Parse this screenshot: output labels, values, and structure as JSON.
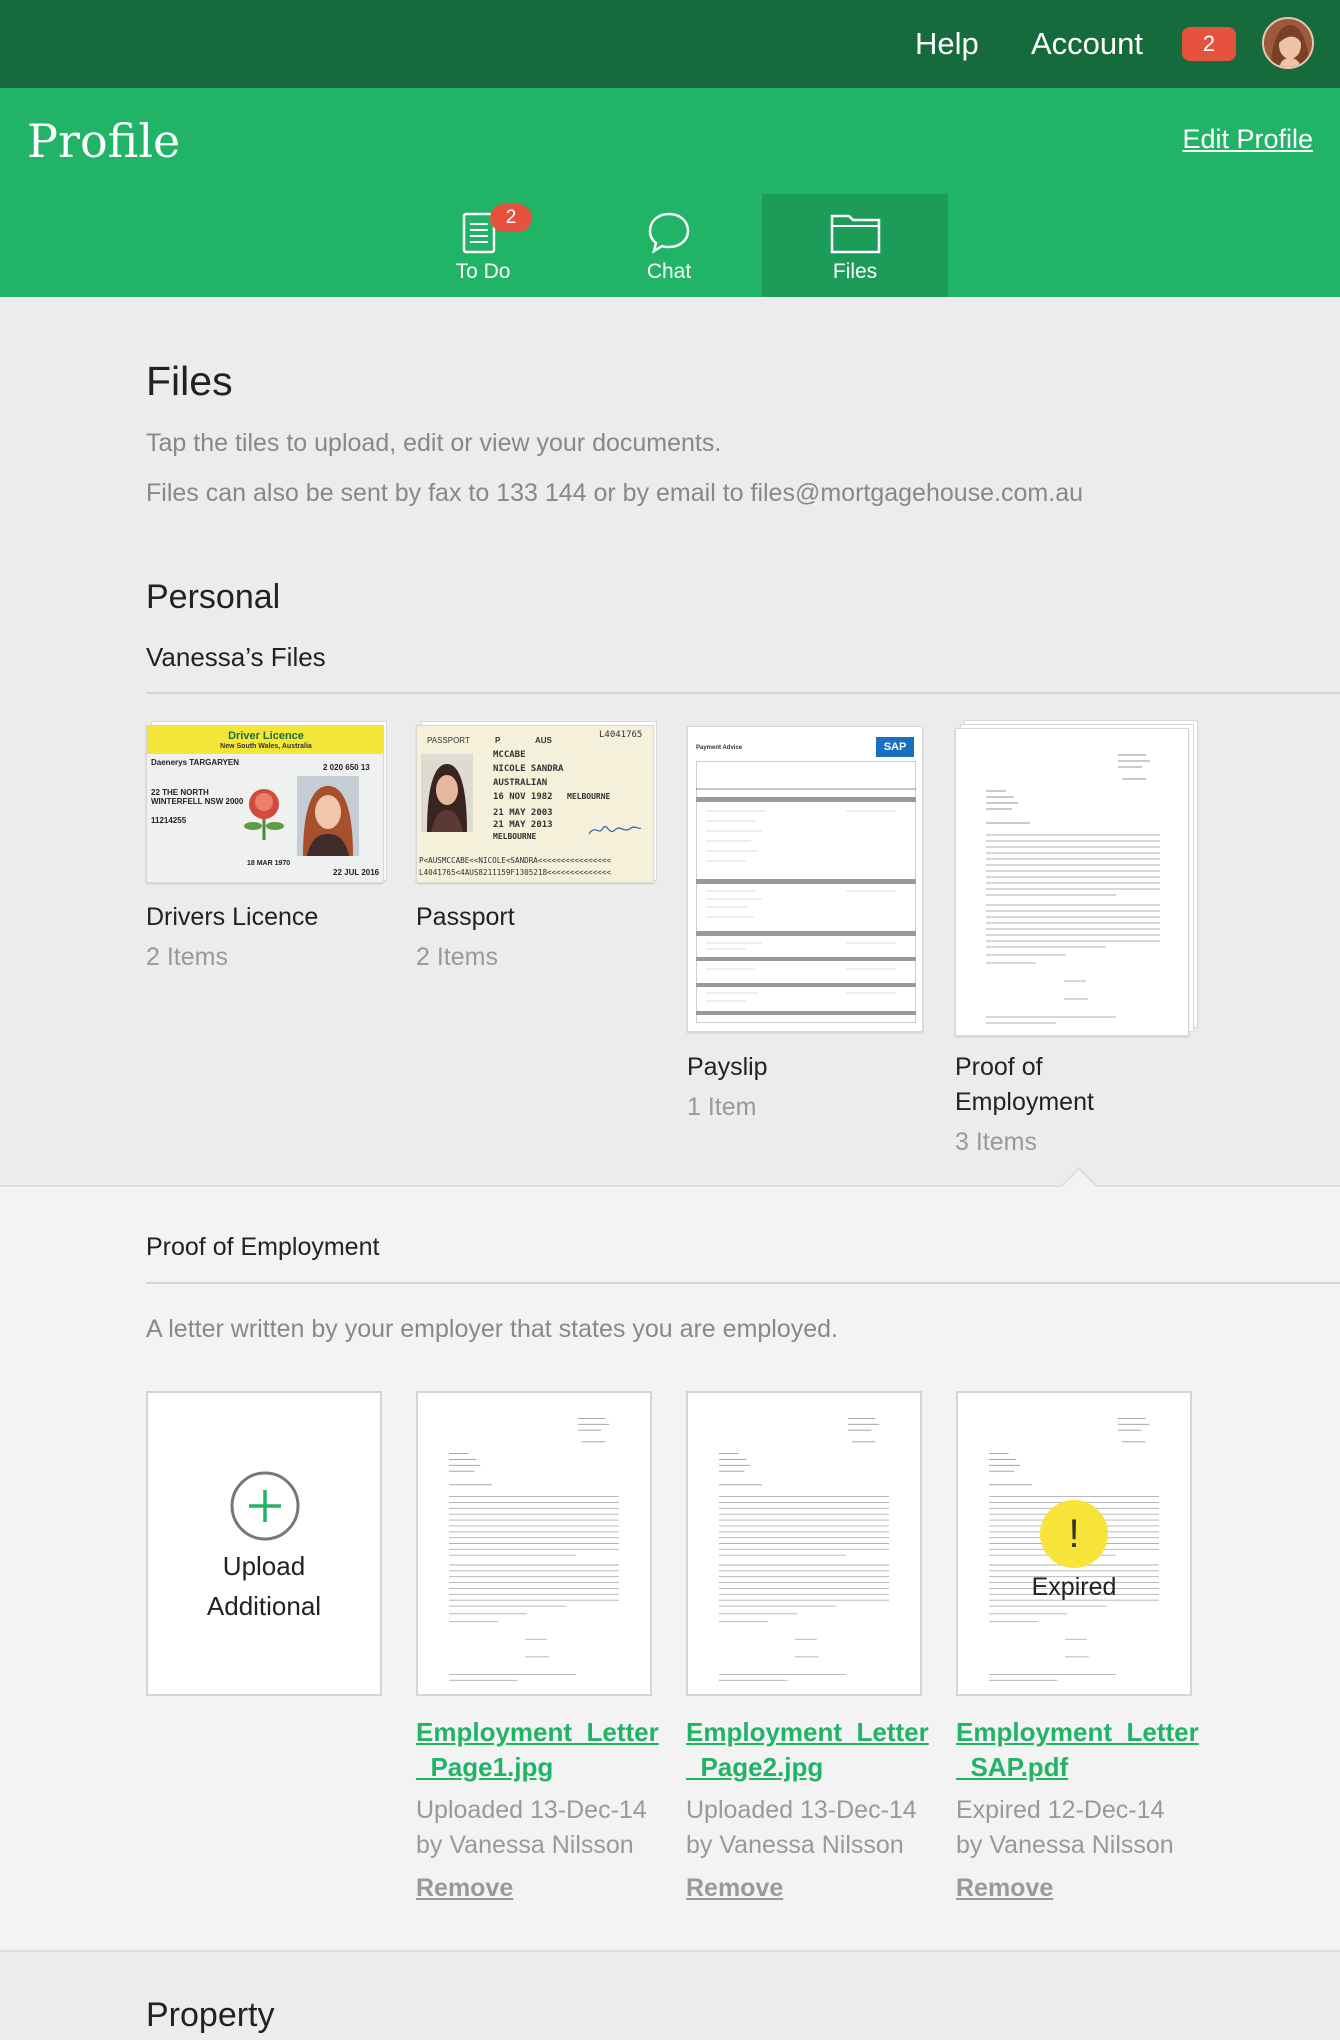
{
  "topbar": {
    "help_label": "Help",
    "account_label": "Account",
    "notification_count": "2"
  },
  "header": {
    "title": "Profile",
    "edit_label": "Edit Profile"
  },
  "tabs": [
    {
      "label": "To Do",
      "badge": "2",
      "icon": "todo-list-icon"
    },
    {
      "label": "Chat",
      "icon": "chat-bubble-icon"
    },
    {
      "label": "Files",
      "icon": "folder-icon",
      "active": true
    }
  ],
  "files": {
    "title": "Files",
    "line1": "Tap the tiles to upload, edit or view your documents.",
    "line2": "Files can also be sent by fax to 133 144 or by email to files@mortgagehouse.com.au"
  },
  "personal": {
    "title": "Personal",
    "subtitle": "Vanessa’s Files",
    "tiles": [
      {
        "label": "Drivers Licence",
        "count": "2 Items"
      },
      {
        "label": "Passport",
        "count": "2 Items"
      },
      {
        "label": "Payslip",
        "count": "1 Item"
      },
      {
        "label": "Proof of Employment",
        "label_line1": "Proof of",
        "label_line2": "Employment",
        "count": "3 Items"
      }
    ],
    "licence": {
      "header": "Driver Licence",
      "state": "New South Wales, Australia",
      "name": "Daenerys TARGARYEN",
      "card_number": "2 020 650 13",
      "address1": "22 THE NORTH",
      "address2": "WINTERFELL NSW 2000",
      "licence_no": "11214255",
      "dob": "18 MAR 1970",
      "expiry": "22 JUL 2016"
    },
    "passport": {
      "type": "PASSPORT",
      "code": "P",
      "country": "AUS",
      "number": "L4041765",
      "surname": "MCCABE",
      "given": "NICOLE SANDRA",
      "nationality": "AUSTRALIAN",
      "dob": "16 NOV 1982",
      "issue": "21 MAY 2003",
      "expiry": "21 MAY 2013",
      "place": "MELBOURNE",
      "issuing": "MELBOURNE",
      "mrz1": "P<AUSMCCABE<<NICOLE<SANDRA<<<<<<<<<<<<<<<<",
      "mrz2": "L4041765<4AUS8211159F1305218<<<<<<<<<<<<<<"
    },
    "payslip": {
      "title": "Payment Advice",
      "logo": "SAP"
    }
  },
  "proof": {
    "title": "Proof of Employment",
    "description": "A letter written by your employer that states you are employed.",
    "upload_line1": "Upload",
    "upload_line2": "Additional",
    "files": [
      {
        "name_line1": "Employment_Letter",
        "name_line2": "_Page1.jpg",
        "meta_line1": "Uploaded 13-Dec-14",
        "meta_line2": "by Vanessa Nilsson",
        "remove": "Remove"
      },
      {
        "name_line1": "Employment_Letter",
        "name_line2": "_Page2.jpg",
        "meta_line1": "Uploaded 13-Dec-14",
        "meta_line2": "by Vanessa Nilsson",
        "remove": "Remove"
      },
      {
        "name_line1": "Employment_Letter",
        "name_line2": "_SAP.pdf",
        "meta_line1": "Expired 12-Dec-14",
        "meta_line2": "by Vanessa Nilsson",
        "remove": "Remove",
        "status": "Expired",
        "status_mark": "!"
      }
    ]
  },
  "property": {
    "title": "Property"
  },
  "colors": {
    "topbar": "#166b3d",
    "brand_green": "#21b366",
    "active_tab": "#1c9c58",
    "badge_red": "#e5533e",
    "expired_yellow": "#f7e43b"
  }
}
